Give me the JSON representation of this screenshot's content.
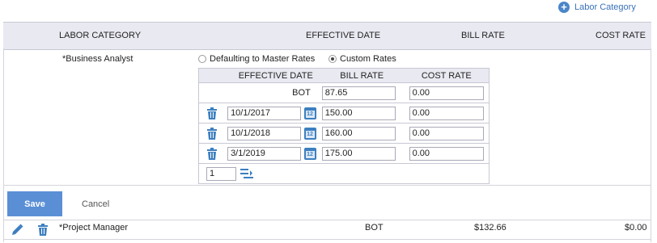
{
  "add_link": {
    "label": "Labor Category"
  },
  "header": {
    "labor_category": "LABOR CATEGORY",
    "effective_date": "EFFECTIVE DATE",
    "bill_rate": "BILL RATE",
    "cost_rate": "COST RATE"
  },
  "editing": {
    "category": "*Business Analyst",
    "radio_master": "Defaulting to Master Rates",
    "radio_custom": "Custom Rates",
    "selected": "custom",
    "rates_table": {
      "headers": [
        "EFFECTIVE DATE",
        "BILL RATE",
        "COST RATE"
      ],
      "bot": {
        "label": "BOT",
        "bill": "87.65",
        "cost": "0.00"
      },
      "rows": [
        {
          "date": "10/1/2017",
          "bill": "150.00",
          "cost": "0.00"
        },
        {
          "date": "10/1/2018",
          "bill": "160.00",
          "cost": "0.00"
        },
        {
          "date": "3/1/2019",
          "bill": "175.00",
          "cost": "0.00"
        }
      ],
      "add_count": "1",
      "calendar_glyph": "12"
    }
  },
  "actions": {
    "save": "Save",
    "cancel": "Cancel"
  },
  "rows": [
    {
      "category": "*Project Manager",
      "effective_date": "BOT",
      "bill_rate": "$132.66",
      "cost_rate": "$0.00"
    }
  ],
  "icons": {
    "edit": "pencil-icon",
    "delete": "trash-icon",
    "add": "plus-circle-icon",
    "calendar": "calendar-icon",
    "add_rows": "add-rows-icon"
  },
  "colors": {
    "accent": "#4a86c8",
    "save_button": "#5a8fd6",
    "header_bg": "#e9e9f2",
    "icon_blue": "#3d7fc0"
  }
}
